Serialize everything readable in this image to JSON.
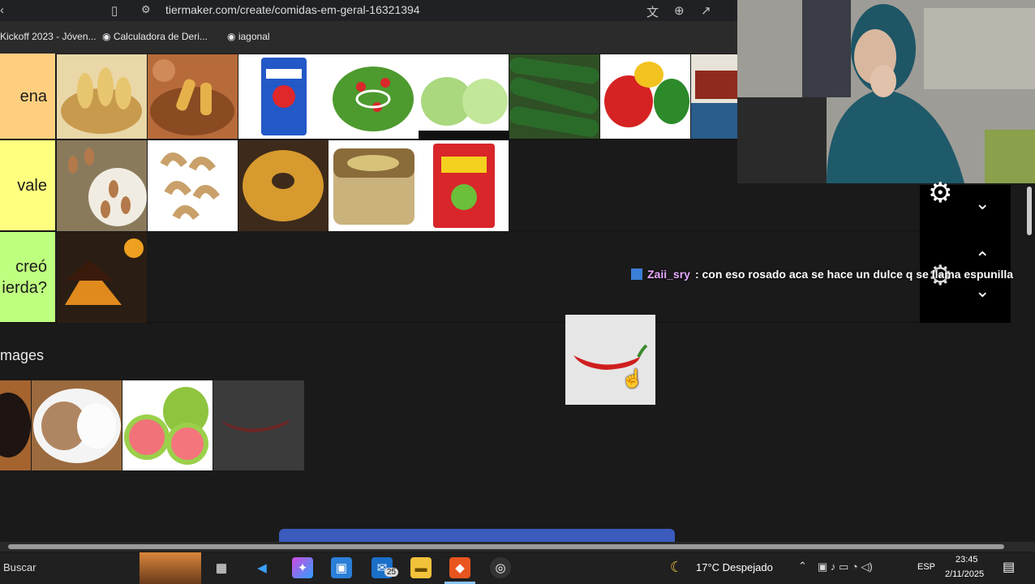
{
  "browser": {
    "url": "tiermaker.com/create/comidas-em-geral-16321394",
    "bookmarks": [
      "Kickoff 2023 - Jóven...",
      "Calculadora de Deri...",
      "iagonal"
    ]
  },
  "tiers": [
    {
      "label": "ena",
      "color": "#ffcf7f"
    },
    {
      "label": "vale",
      "color": "#ffff7f"
    },
    {
      "label": "creó\nierda?",
      "color": "#bfff7f"
    }
  ],
  "images_section": {
    "title": "mages"
  },
  "chat": {
    "user": "Zaii_sry",
    "message": ": con eso rosado aca se hace un dulce q se llama espunilla"
  },
  "taskbar": {
    "search_placeholder": "Buscar",
    "mail_badge": "25",
    "weather": "17°C  Despejado",
    "language": "ESP",
    "time": "23:45",
    "date": "2/11/2025"
  },
  "colors": {
    "background": "#1a1a1a",
    "taskbar": "#202020",
    "accent_blue": "#3b5bbd"
  }
}
